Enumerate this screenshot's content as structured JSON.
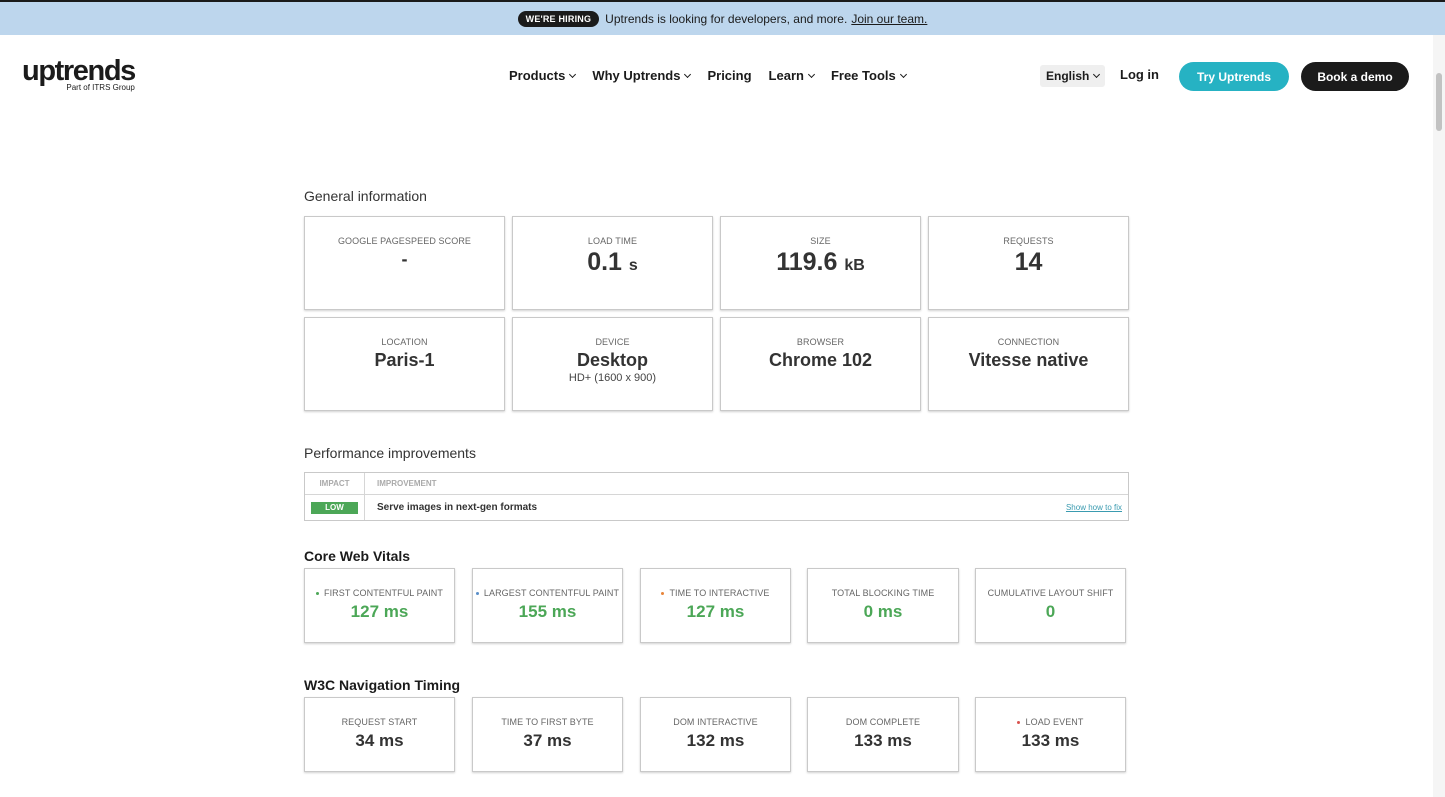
{
  "colors": {
    "accent": "#26b2c3",
    "good": "#4ca757",
    "dark": "#1b1b1b",
    "hiring_bg": "#bdd6ed"
  },
  "hiring": {
    "badge": "WE'RE HIRING",
    "text": "Uptrends is looking for developers, and more.",
    "link": "Join our team."
  },
  "header": {
    "logo": "uptrends",
    "logo_sub": "Part of ITRS Group",
    "nav": [
      {
        "label": "Products",
        "has_dropdown": true
      },
      {
        "label": "Why Uptrends",
        "has_dropdown": true
      },
      {
        "label": "Pricing",
        "has_dropdown": false
      },
      {
        "label": "Learn",
        "has_dropdown": true
      },
      {
        "label": "Free Tools",
        "has_dropdown": true
      }
    ],
    "language": "English",
    "login": "Log in",
    "try_button": "Try Uptrends",
    "demo_button": "Book a demo"
  },
  "general": {
    "title": "General information",
    "pagespeed": {
      "label": "GOOGLE PAGESPEED SCORE",
      "value": "-"
    },
    "load_time": {
      "label": "LOAD TIME",
      "value": "0.1",
      "unit": "s"
    },
    "size": {
      "label": "SIZE",
      "value": "119.6",
      "unit": "kB"
    },
    "requests": {
      "label": "REQUESTS",
      "value": "14"
    },
    "location": {
      "label": "LOCATION",
      "value": "Paris-1"
    },
    "device": {
      "label": "DEVICE",
      "value": "Desktop",
      "sub": "HD+ (1600 x 900)"
    },
    "browser": {
      "label": "BROWSER",
      "value": "Chrome 102"
    },
    "connection": {
      "label": "CONNECTION",
      "value": "Vitesse native"
    }
  },
  "performance": {
    "title": "Performance improvements",
    "col_impact": "IMPACT",
    "col_improvement": "IMPROVEMENT",
    "rows": [
      {
        "impact": "LOW",
        "text": "Serve images in next-gen formats",
        "link": "Show how to fix"
      }
    ]
  },
  "core_web_vitals": {
    "title": "Core Web Vitals",
    "items": [
      {
        "label": "FIRST CONTENTFUL PAINT",
        "value": "127 ms",
        "dot_color": "#4ca757"
      },
      {
        "label": "LARGEST CONTENTFUL PAINT",
        "value": "155 ms",
        "dot_color": "#5a8ec9"
      },
      {
        "label": "TIME TO INTERACTIVE",
        "value": "127 ms",
        "dot_color": "#e8843a"
      },
      {
        "label": "TOTAL BLOCKING TIME",
        "value": "0 ms"
      },
      {
        "label": "CUMULATIVE LAYOUT SHIFT",
        "value": "0"
      }
    ]
  },
  "w3c": {
    "title": "W3C Navigation Timing",
    "items": [
      {
        "label": "REQUEST START",
        "value": "34 ms"
      },
      {
        "label": "TIME TO FIRST BYTE",
        "value": "37 ms"
      },
      {
        "label": "DOM INTERACTIVE",
        "value": "132 ms"
      },
      {
        "label": "DOM COMPLETE",
        "value": "133 ms"
      },
      {
        "label": "LOAD EVENT",
        "value": "133 ms",
        "dot_color": "#d9534f"
      }
    ]
  }
}
